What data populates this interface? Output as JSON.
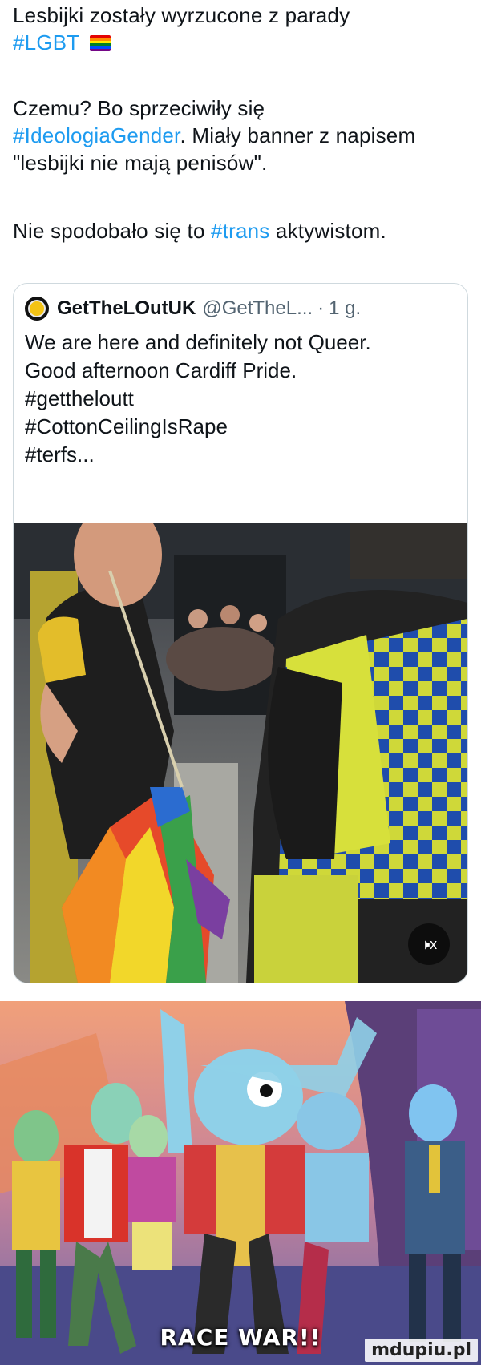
{
  "post": {
    "line1": "Lesbijki zostały wyrzucone z parady",
    "hashtag_lgbt": "#LGBT",
    "para2_pre": "Czemu? Bo sprzeciwiły się",
    "hashtag_ideologia": "#IdeologiaGender",
    "para2_post": ". Miały banner z napisem \"lesbijki nie mają penisów\".",
    "para3_pre": "Nie spodobało się to ",
    "hashtag_trans": "#trans",
    "para3_post": " aktywistom."
  },
  "quote": {
    "author_name": "GetTheLOutUK",
    "author_handle": "@GetTheL...",
    "separator": "·",
    "time": "1 g.",
    "text": "We are here and definitely not Queer.\nGood afternoon Cardiff Pride.\n#gettheloutt\n#CottonCeilingIsRape\n#terfs...",
    "media_mute_icon": "mute-speaker-icon",
    "media_mute_label": "🕨x"
  },
  "meme": {
    "caption": "RACE WAR!!"
  },
  "watermark": "mdupiu.pl",
  "colors": {
    "hashtag": "#1d9bf0",
    "text": "#0f1419",
    "secondary": "#536471",
    "border": "#cfd9de"
  }
}
